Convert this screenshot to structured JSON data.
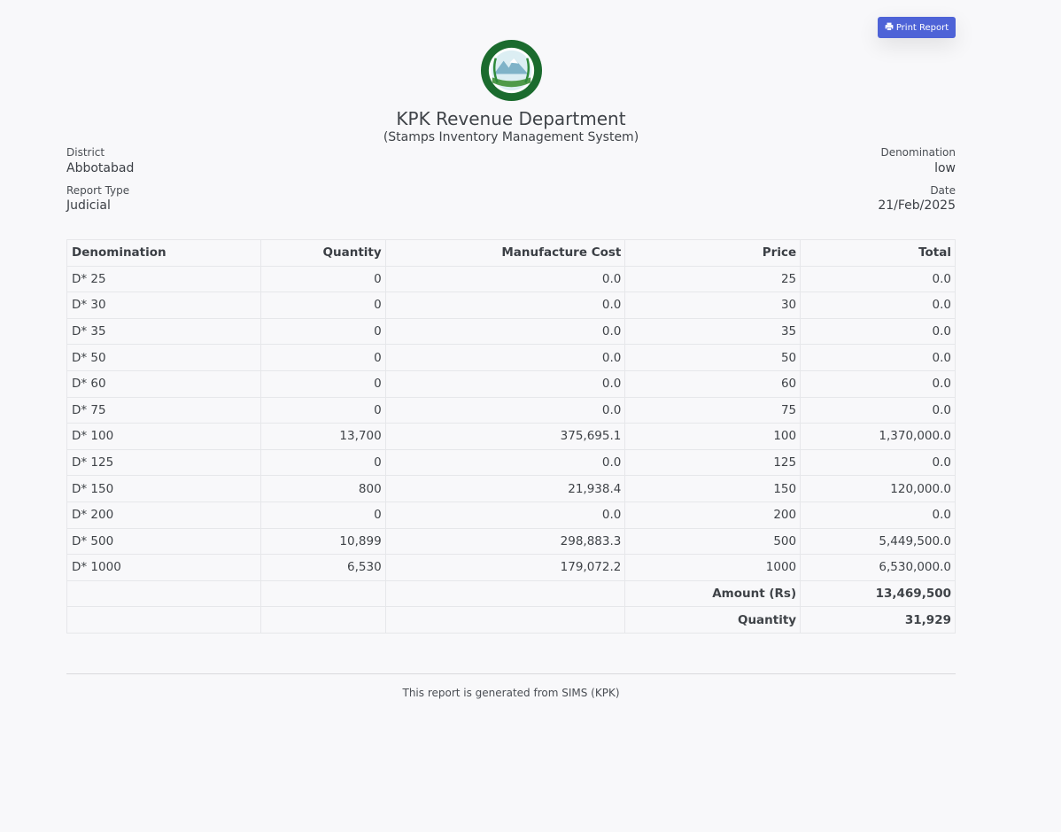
{
  "print_button": {
    "label": "Print Report",
    "icon": "printer-icon",
    "color": "#4e63d7"
  },
  "logo": {
    "icon": "kpk-revenue-seal-icon",
    "color": "#1b6b2e"
  },
  "header": {
    "title": "KPK Revenue Department",
    "subtitle": "(Stamps Inventory Management System)"
  },
  "meta": {
    "district_label": "District",
    "district_value": "Abbotabad",
    "report_type_label": "Report Type",
    "report_type_value": "Judicial",
    "denomination_label": "Denomination",
    "denomination_value": "low",
    "date_label": "Date",
    "date_value": "21/Feb/2025"
  },
  "table": {
    "headers": [
      "Denomination",
      "Quantity",
      "Manufacture Cost",
      "Price",
      "Total"
    ],
    "rows": [
      [
        "D* 25",
        "0",
        "0.0",
        "25",
        "0.0"
      ],
      [
        "D* 30",
        "0",
        "0.0",
        "30",
        "0.0"
      ],
      [
        "D* 35",
        "0",
        "0.0",
        "35",
        "0.0"
      ],
      [
        "D* 50",
        "0",
        "0.0",
        "50",
        "0.0"
      ],
      [
        "D* 60",
        "0",
        "0.0",
        "60",
        "0.0"
      ],
      [
        "D* 75",
        "0",
        "0.0",
        "75",
        "0.0"
      ],
      [
        "D* 100",
        "13,700",
        "375,695.1",
        "100",
        "1,370,000.0"
      ],
      [
        "D* 125",
        "0",
        "0.0",
        "125",
        "0.0"
      ],
      [
        "D* 150",
        "800",
        "21,938.4",
        "150",
        "120,000.0"
      ],
      [
        "D* 200",
        "0",
        "0.0",
        "200",
        "0.0"
      ],
      [
        "D* 500",
        "10,899",
        "298,883.3",
        "500",
        "5,449,500.0"
      ],
      [
        "D* 1000",
        "6,530",
        "179,072.2",
        "1000",
        "6,530,000.0"
      ]
    ],
    "summary": [
      {
        "label": "Amount (Rs)",
        "value": "13,469,500"
      },
      {
        "label": "Quantity",
        "value": "31,929"
      }
    ]
  },
  "footer": {
    "text": "This report is generated from SIMS (KPK)"
  }
}
